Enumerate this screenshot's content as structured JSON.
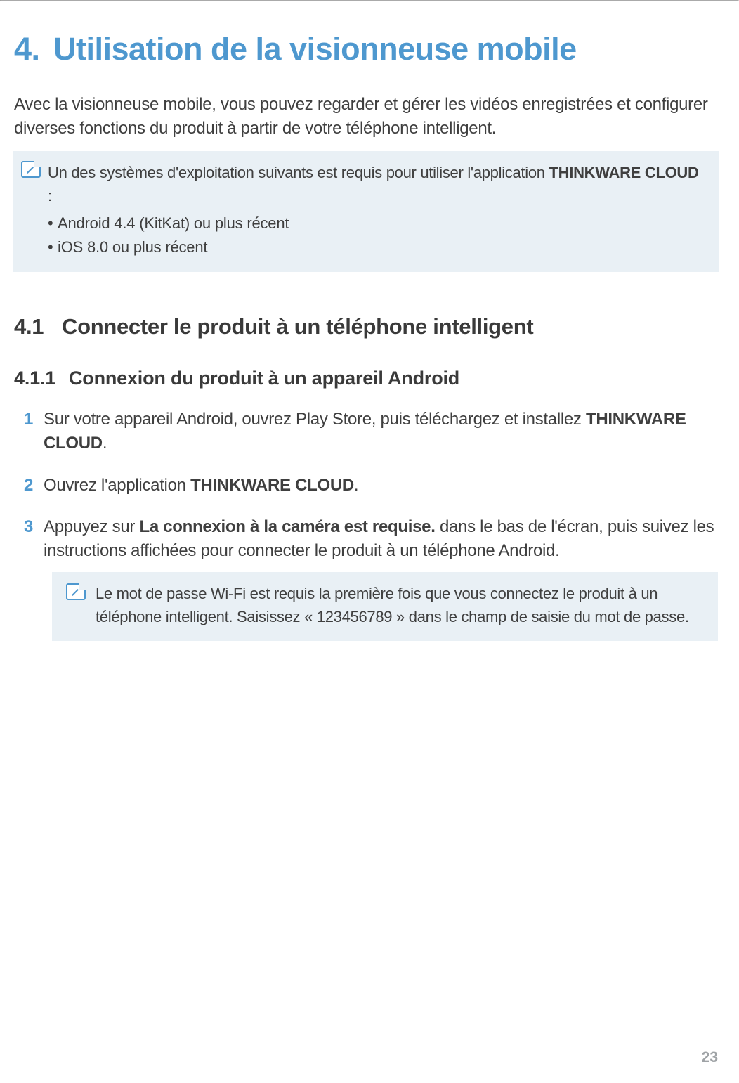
{
  "chapter": {
    "num": "4.",
    "title": "Utilisation de la visionneuse mobile"
  },
  "intro": "Avec la visionneuse mobile, vous pouvez regarder et gérer les vidéos enregistrées et configurer diverses fonctions du produit à partir de votre téléphone intelligent.",
  "note1": {
    "lead_a": "Un des systèmes d'exploitation suivants est requis pour utiliser l'application ",
    "lead_bold": "THINKWARE CLOUD",
    "lead_b": " :",
    "b1": "Android 4.4 (KitKat) ou plus récent",
    "b2": " iOS 8.0 ou plus récent"
  },
  "h2": {
    "num": "4.1",
    "title": "Connecter le produit à un téléphone intelligent"
  },
  "h3": {
    "num": "4.1.1",
    "title": "Connexion du produit à un appareil Android"
  },
  "steps": {
    "s1": {
      "a": "Sur votre appareil Android, ouvrez Play Store, puis téléchargez et installez ",
      "bold": "THINKWARE CLOUD",
      "b": "."
    },
    "s2": {
      "a": "Ouvrez l'application ",
      "bold": "THINKWARE CLOUD",
      "b": "."
    },
    "s3": {
      "a": "Appuyez sur ",
      "bold": "La connexion à la caméra est requise.",
      "b": " dans le bas de l'écran, puis suivez les instructions affichées pour connecter le produit à un téléphone Android."
    }
  },
  "note2": "Le mot de passe Wi-Fi est requis la première fois que vous connectez le produit à un téléphone intelligent. Saisissez « 123456789 » dans le champ de saisie du mot de passe.",
  "pagenum": "23"
}
